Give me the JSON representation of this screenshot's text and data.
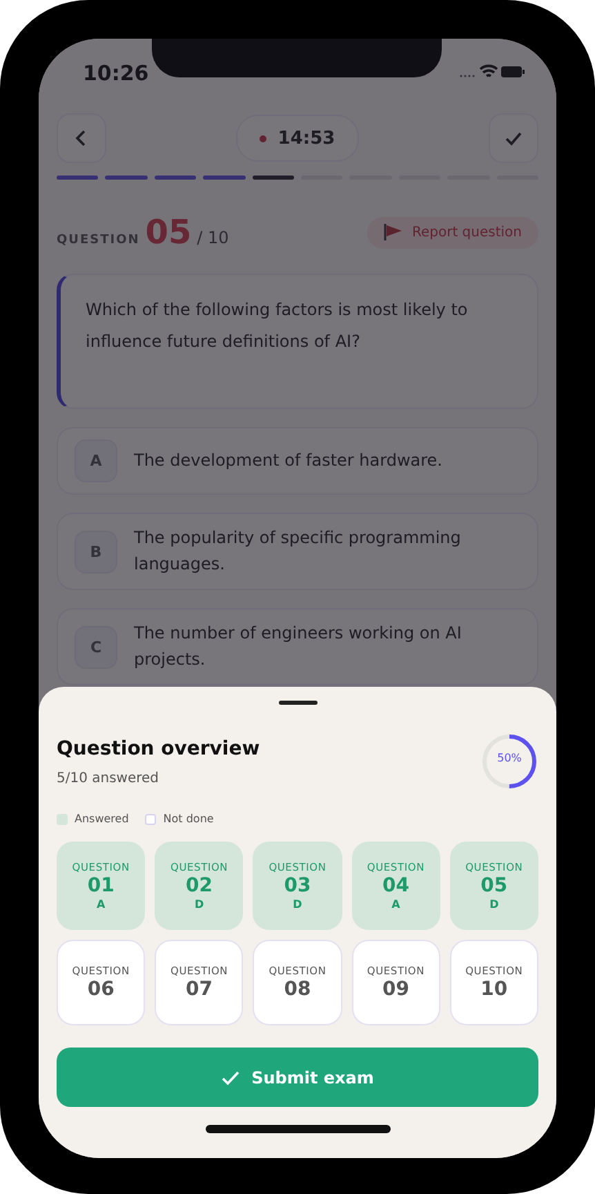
{
  "status_bar": {
    "time": "10:26"
  },
  "header": {
    "timer": "14:53"
  },
  "progress": [
    {
      "kind": "done"
    },
    {
      "kind": "done"
    },
    {
      "kind": "done"
    },
    {
      "kind": "done"
    },
    {
      "kind": "current"
    },
    {
      "kind": "pending"
    },
    {
      "kind": "pending"
    },
    {
      "kind": "pending"
    },
    {
      "kind": "pending"
    },
    {
      "kind": "pending"
    }
  ],
  "question": {
    "label": "QUESTION",
    "number": "05",
    "total": "/ 10",
    "report": "Report question",
    "text": "Which of the following factors is most likely to influence future definitions of AI?"
  },
  "options": [
    {
      "letter": "A",
      "text": "The development of faster hardware."
    },
    {
      "letter": "B",
      "text": "The popularity of specific programming languages."
    },
    {
      "letter": "C",
      "text": "The number of engineers working on AI projects."
    }
  ],
  "overview": {
    "title": "Question overview",
    "subtitle": "5/10 answered",
    "ring": {
      "level": 0.5,
      "label": "50%"
    },
    "legend": [
      {
        "kind": "answered",
        "label": "Answered"
      },
      {
        "kind": "not_done",
        "label": "Not done"
      }
    ],
    "questions": [
      {
        "label": "QUESTION",
        "number": "01",
        "answer": "A",
        "answered": true
      },
      {
        "label": "QUESTION",
        "number": "02",
        "answer": "D",
        "answered": true
      },
      {
        "label": "QUESTION",
        "number": "03",
        "answer": "D",
        "answered": true
      },
      {
        "label": "QUESTION",
        "number": "04",
        "answer": "A",
        "answered": true
      },
      {
        "label": "QUESTION",
        "number": "05",
        "answer": "D",
        "answered": true
      },
      {
        "label": "QUESTION",
        "number": "06",
        "answered": false
      },
      {
        "label": "QUESTION",
        "number": "07",
        "answered": false
      },
      {
        "label": "QUESTION",
        "number": "08",
        "answered": false
      },
      {
        "label": "QUESTION",
        "number": "09",
        "answered": false
      },
      {
        "label": "QUESTION",
        "number": "10",
        "answered": false
      }
    ],
    "submit": "Submit exam"
  }
}
